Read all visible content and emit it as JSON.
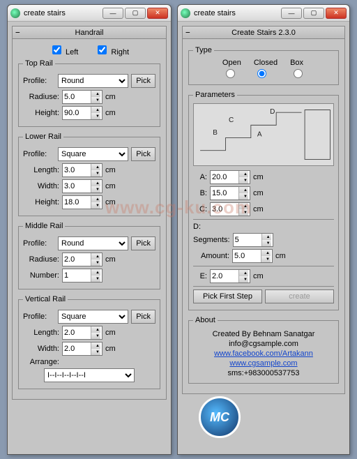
{
  "watermark": "www.cg-ku.com",
  "leftWin": {
    "title": "create stairs",
    "rollout": "Handrail",
    "collapse": "−",
    "left": "Left",
    "right": "Right",
    "topRail": {
      "legend": "Top Rail",
      "profileLabel": "Profile:",
      "profile": "Round",
      "pick": "Pick",
      "radiuseLabel": "Radiuse:",
      "radiuse": "5.0",
      "heightLabel": "Height:",
      "height": "90.0",
      "cm": "cm"
    },
    "lowerRail": {
      "legend": "Lower Rail",
      "profileLabel": "Profile:",
      "profile": "Square",
      "pick": "Pick",
      "lengthLabel": "Length:",
      "length": "3.0",
      "widthLabel": "Width:",
      "width": "3.0",
      "heightLabel": "Height:",
      "height": "18.0",
      "cm": "cm"
    },
    "middleRail": {
      "legend": "Middle Rail",
      "profileLabel": "Profile:",
      "profile": "Round",
      "pick": "Pick",
      "radiuseLabel": "Radiuse:",
      "radiuse": "2.0",
      "numberLabel": "Number:",
      "number": "1",
      "cm": "cm"
    },
    "verticalRail": {
      "legend": "Vertical Rail",
      "profileLabel": "Profile:",
      "profile": "Square",
      "pick": "Pick",
      "lengthLabel": "Length:",
      "length": "2.0",
      "widthLabel": "Width:",
      "width": "2.0",
      "arrangeLabel": "Arrange:",
      "arrange": "I--I--I--I--I--I",
      "cm": "cm"
    }
  },
  "rightWin": {
    "title": "create stairs",
    "rollout": "Create Stairs 2.3.0",
    "collapse": "−",
    "type": {
      "legend": "Type",
      "open": "Open",
      "closed": "Closed",
      "box": "Box"
    },
    "params": {
      "legend": "Parameters",
      "diagA": "A",
      "diagB": "B",
      "diagC": "C",
      "diagD": "D",
      "aLabel": "A:",
      "a": "20.0",
      "bLabel": "B:",
      "b": "15.0",
      "cLabel": "C:",
      "c": "3.0",
      "dLabel": "D:",
      "segmentsLabel": "Segments:",
      "segments": "5",
      "amountLabel": "Amount:",
      "amount": "5.0",
      "eLabel": "E:",
      "e": "2.0",
      "cm": "cm",
      "pickFirst": "Pick First Step",
      "create": "create"
    },
    "about": {
      "legend": "About",
      "l1": "Created By Behnam Sanatgar",
      "l2": "info@cgsample.com",
      "l3": "www.facebook.com/Artakann",
      "l4": "www.cgsample.com",
      "l5": "sms:+983000537753"
    }
  }
}
